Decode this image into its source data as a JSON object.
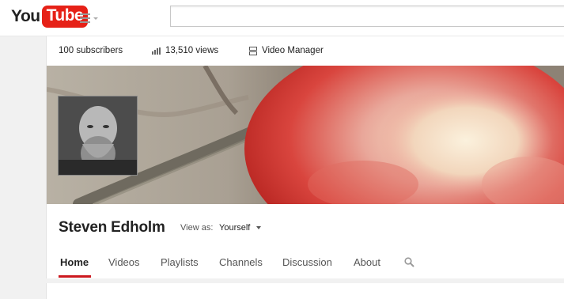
{
  "masthead": {
    "logo_you": "You",
    "logo_tube": "Tube",
    "guide_icon": "hamburger-menu-icon",
    "search_placeholder": ""
  },
  "stats": {
    "subscribers": "100 subscribers",
    "views": "13,510 views",
    "views_icon": "bar-chart-icon",
    "video_manager": "Video Manager",
    "video_manager_icon": "video-manager-icon"
  },
  "channel": {
    "name": "Steven Edholm",
    "view_as_label": "View as:",
    "view_as_value": "Yourself"
  },
  "tabs": [
    {
      "label": "Home",
      "active": true
    },
    {
      "label": "Videos"
    },
    {
      "label": "Playlists"
    },
    {
      "label": "Channels"
    },
    {
      "label": "Discussion"
    },
    {
      "label": "About"
    }
  ],
  "colors": {
    "brand_red": "#e62117",
    "tab_active_underline": "#cc181e",
    "background": "#f1f1f1"
  }
}
